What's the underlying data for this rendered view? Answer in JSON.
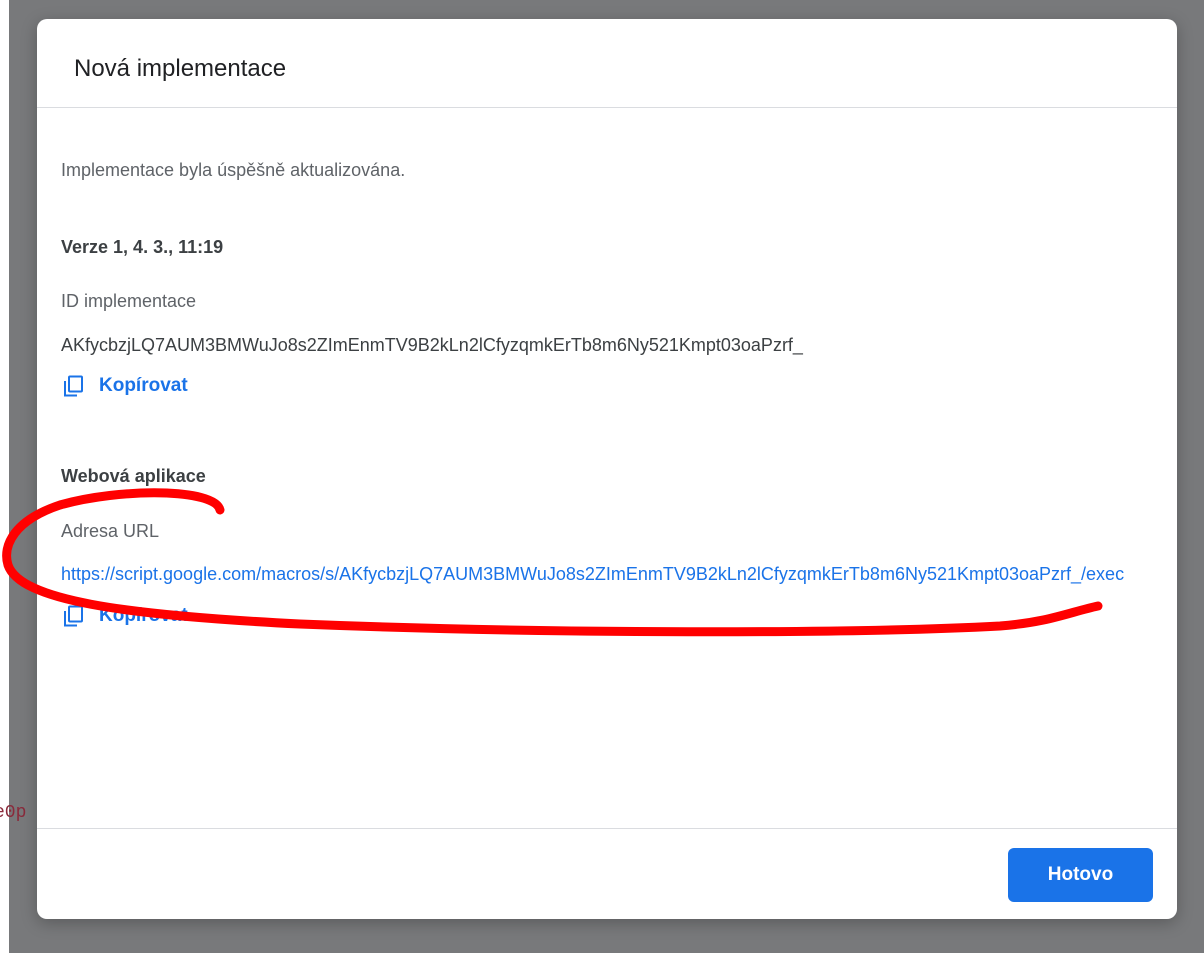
{
  "background": {
    "peek_text": "e0p"
  },
  "dialog": {
    "title": "Nová implementace",
    "status": "Implementace byla úspěšně aktualizována.",
    "version_heading": "Verze 1, 4. 3., 11:19",
    "deployment_id_label": "ID implementace",
    "deployment_id_value": "AKfycbzjLQ7AUM3BMWuJo8s2ZImEnmTV9B2kLn2lCfyzqmkErTb8m6Ny521Kmpt03oaPzrf_",
    "copy_label": "Kopírovat",
    "webapp_heading": "Webová aplikace",
    "url_label": "Adresa URL",
    "url_value": "https://script.google.com/macros/s/AKfycbzjLQ7AUM3BMWuJo8s2ZImEnmTV9B2kLn2lCfyzqmkErTb8m6Ny521Kmpt03oaPzrf_/exec",
    "done_button": "Hotovo"
  },
  "colors": {
    "accent": "#1a73e8",
    "backdrop": "#78797b",
    "annotation": "#ff0000"
  },
  "icons": {
    "copy": "copy-icon"
  }
}
